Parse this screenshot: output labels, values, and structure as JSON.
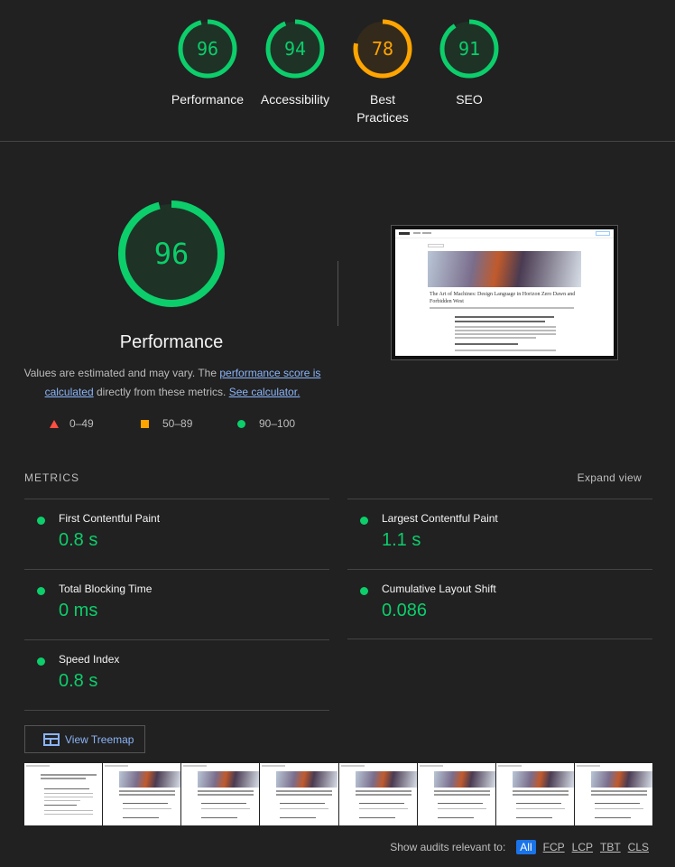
{
  "category_gauges": [
    {
      "label": "Performance",
      "score": "96",
      "fraction": 0.96,
      "color": "#0cce6b"
    },
    {
      "label": "Accessibility",
      "score": "94",
      "fraction": 0.94,
      "color": "#0cce6b"
    },
    {
      "label": "Best Practices",
      "score": "78",
      "fraction": 0.78,
      "color": "#ffa400"
    },
    {
      "label": "SEO",
      "score": "91",
      "fraction": 0.91,
      "color": "#0cce6b"
    }
  ],
  "performance": {
    "score": "96",
    "fraction": 0.96,
    "title": "Performance",
    "desc_prefix": "Values are estimated and may vary. The ",
    "score_link": "performance score is calculated",
    "desc_middle": " directly from these metrics. ",
    "calc_link": "See calculator."
  },
  "legend": {
    "fail": "0–49",
    "average": "50–89",
    "pass": "90–100"
  },
  "screenshot": {
    "title": "The Art of Machines: Design Language in Horizon Zero Dawn and Forbidden West"
  },
  "metrics": {
    "header": "METRICS",
    "expand_label": "Expand view",
    "items": [
      {
        "name": "First Contentful Paint",
        "value": "0.8 s"
      },
      {
        "name": "Largest Contentful Paint",
        "value": "1.1 s"
      },
      {
        "name": "Total Blocking Time",
        "value": "0 ms"
      },
      {
        "name": "Cumulative Layout Shift",
        "value": "0.086"
      },
      {
        "name": "Speed Index",
        "value": "0.8 s"
      }
    ]
  },
  "treemap_label": "View Treemap",
  "audits_filter": {
    "label": "Show audits relevant to:",
    "chips": [
      "All",
      "FCP",
      "LCP",
      "TBT",
      "CLS"
    ],
    "active": "All"
  },
  "colors": {
    "pass": "#0cce6b",
    "average": "#ffa400",
    "fail": "#ff4e42",
    "link": "#8ab4f8",
    "background": "#212121"
  }
}
